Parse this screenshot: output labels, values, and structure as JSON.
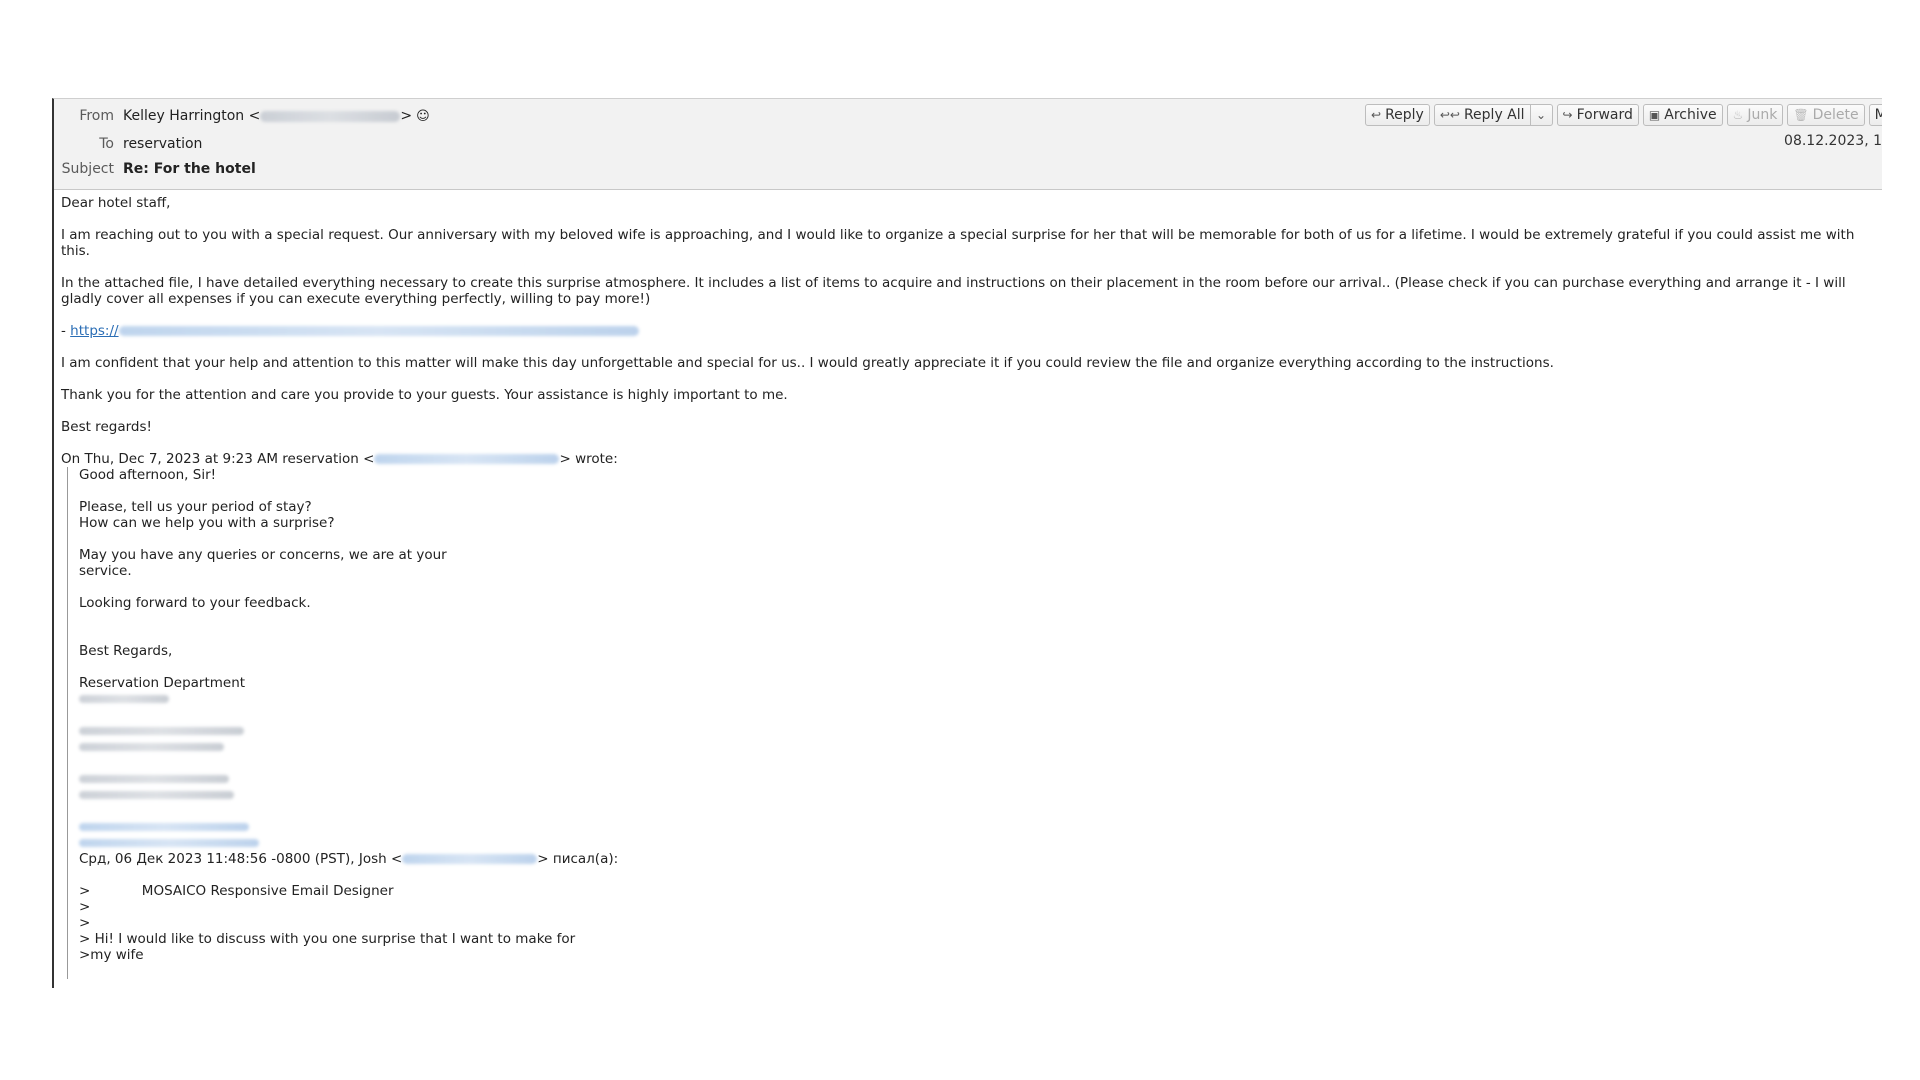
{
  "header": {
    "from_label": "From",
    "from_name": "Kelley Harrington <",
    "from_close": ">",
    "to_label": "To",
    "to_value": "reservation",
    "subject_label": "Subject",
    "subject_value": "Re: For the hotel",
    "date": "08.12.2023, 1"
  },
  "toolbar": {
    "reply": "Reply",
    "reply_all": "Reply All",
    "forward": "Forward",
    "archive": "Archive",
    "junk": "Junk",
    "delete": "Delete",
    "more": "Mo"
  },
  "icons": {
    "reply": "↩",
    "reply_all": "↩↩",
    "dropdown": "⌄",
    "forward": "↪",
    "archive": "▣",
    "junk": "♨",
    "delete": "🗑",
    "contact": "☺"
  },
  "body": {
    "greeting": "Dear hotel staff,",
    "p1": "I am reaching out to you with a special request. Our anniversary with my beloved wife is approaching, and I would like to organize a special surprise for her that will be memorable for both of us for a lifetime. I would be extremely grateful if you could assist me with this.",
    "p2": "In the attached file, I have detailed everything necessary to create this surprise atmosphere. It includes a list of items to acquire and instructions on their placement in the room before our arrival.. (Please check if you can purchase everything and arrange it - I will gladly cover all expenses if you can execute everything perfectly, willing to pay more!)",
    "link_prefix": "- ",
    "link_text": "https://",
    "p3": "I am confident that your help and attention to this matter will make this day unforgettable and special for us.. I would greatly appreciate it if you could review the file and organize everything according to the instructions.",
    "p4": "Thank you for the attention and care you provide to your guests. Your assistance is highly important to me.",
    "signoff": "Best regards!",
    "attribution_prefix": "On Thu, Dec 7, 2023 at 9:23 AM reservation <",
    "attribution_suffix": "> wrote:"
  },
  "quote": {
    "l1": "Good afternoon, Sir!",
    "l2": "Please, tell us your period of stay?",
    "l3": "How can we help you with a surprise?",
    "l4": "May you have any queries or concerns, we are at your",
    "l5": "service.",
    "l6": "Looking forward to your feedback.",
    "l7": "Best Regards,",
    "l8": "Reservation Department",
    "attribution2_prefix": "Срд, 06 Дек 2023 11:48:56 -0800 (PST), Josh <",
    "attribution2_suffix": "> писал(а):",
    "n1": ">            MOSAICO Responsive Email Designer",
    "n2": ">",
    "n3": ">",
    "n4": "> Hi! I would like to discuss with you one surprise that I want to make for",
    "n5": ">my wife"
  }
}
